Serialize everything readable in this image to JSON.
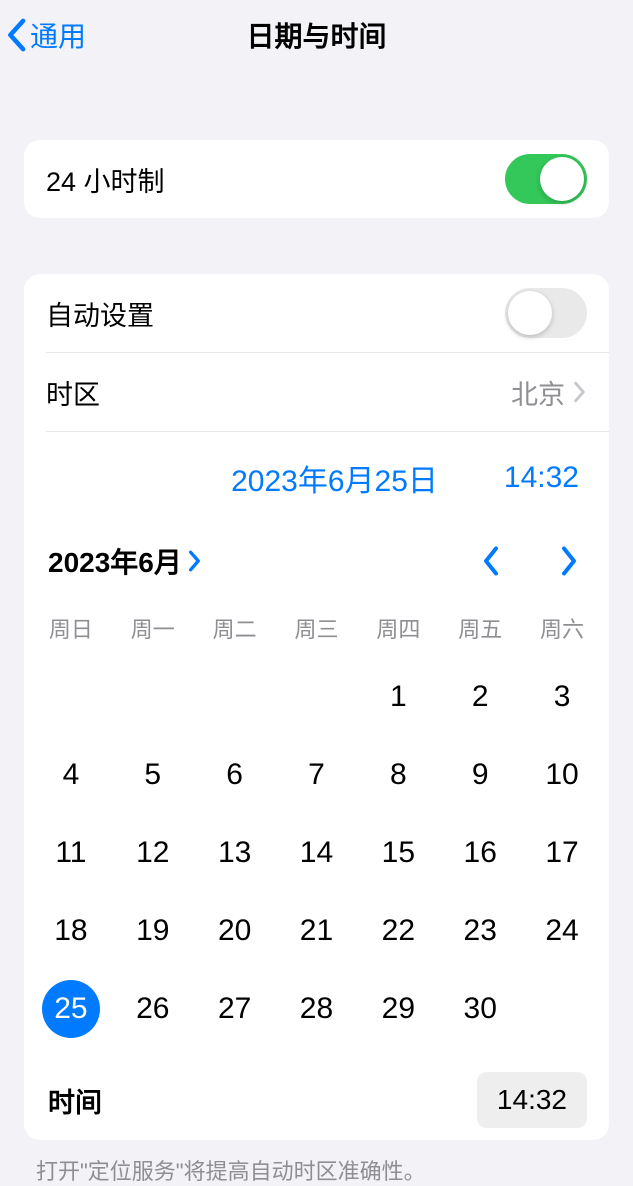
{
  "nav": {
    "back_label": "通用",
    "title": "日期与时间"
  },
  "twenty_four_hour": {
    "label": "24 小时制",
    "enabled": true
  },
  "auto_set": {
    "label": "自动设置",
    "enabled": false
  },
  "timezone": {
    "label": "时区",
    "value": "北京"
  },
  "current": {
    "date": "2023年6月25日",
    "time": "14:32"
  },
  "calendar": {
    "month_label": "2023年6月",
    "weekdays": [
      "周日",
      "周一",
      "周二",
      "周三",
      "周四",
      "周五",
      "周六"
    ],
    "first_weekday_index": 4,
    "days_in_month": 30,
    "selected_day": 25
  },
  "time_row": {
    "label": "时间",
    "value": "14:32"
  },
  "footer": {
    "note": "打开\"定位服务\"将提高自动时区准确性。"
  }
}
